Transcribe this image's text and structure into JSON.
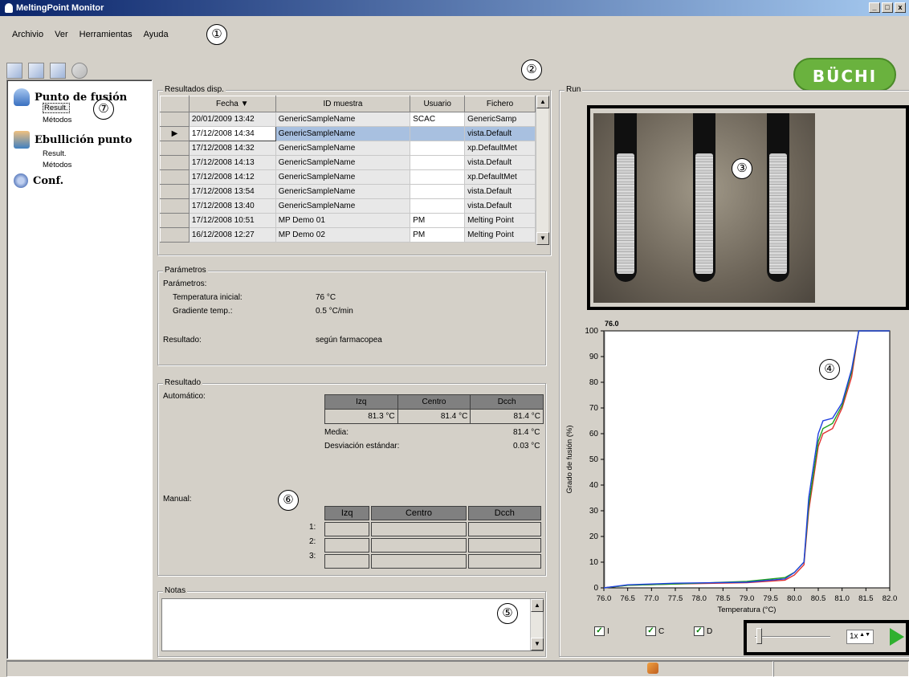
{
  "window": {
    "title": "MeltingPoint Monitor",
    "min": "_",
    "max": "□",
    "close": "x"
  },
  "menu": [
    "Archivio",
    "Ver",
    "Herramientas",
    "Ayuda"
  ],
  "callouts": [
    "①",
    "②",
    "③",
    "④",
    "⑤",
    "⑥",
    "⑦"
  ],
  "logo": "BÜCHI",
  "sidebar": {
    "melting": {
      "title": "Punto de fusión",
      "result": "Result.",
      "methods": "Métodos"
    },
    "boiling": {
      "title": "Ebullición punto",
      "result": "Result.",
      "methods": "Métodos"
    },
    "conf": "Conf."
  },
  "results": {
    "title": "Resultados disp.",
    "headers": {
      "date": "Fecha",
      "sample": "ID muestra",
      "user": "Usuario",
      "file": "Fichero"
    },
    "rows": [
      {
        "date": "20/01/2009 13:42",
        "sample": "GenericSampleName",
        "user": "SCAC",
        "file": "GenericSamp"
      },
      {
        "date": "17/12/2008 14:34",
        "sample": "GenericSampleName",
        "user": "",
        "file": "vista.Default",
        "marker": "▶"
      },
      {
        "date": "17/12/2008 14:32",
        "sample": "GenericSampleName",
        "user": "",
        "file": "xp.DefaultMet"
      },
      {
        "date": "17/12/2008 14:13",
        "sample": "GenericSampleName",
        "user": "",
        "file": "vista.Default"
      },
      {
        "date": "17/12/2008 14:12",
        "sample": "GenericSampleName",
        "user": "",
        "file": "xp.DefaultMet"
      },
      {
        "date": "17/12/2008 13:54",
        "sample": "GenericSampleName",
        "user": "",
        "file": "vista.Default"
      },
      {
        "date": "17/12/2008 13:40",
        "sample": "GenericSampleName",
        "user": "",
        "file": "vista.Default"
      },
      {
        "date": "17/12/2008 10:51",
        "sample": "MP Demo 01",
        "user": "PM",
        "file": "Melting Point"
      },
      {
        "date": "16/12/2008 12:27",
        "sample": "MP Demo 02",
        "user": "PM",
        "file": "Melting Point"
      }
    ]
  },
  "params": {
    "title": "Parámetros",
    "subtitle": "Parámetros:",
    "start_temp_label": "Temperatura inicial:",
    "start_temp": "76 °C",
    "gradient_label": "Gradiente temp.:",
    "gradient": "0.5 °C/min",
    "result_label": "Resultado:",
    "result": "según farmacopea"
  },
  "result": {
    "title": "Resultado",
    "auto_label": "Automático:",
    "cols": [
      "Izq",
      "Centro",
      "Dcch"
    ],
    "auto_values": [
      "81.3 °C",
      "81.4 °C",
      "81.4 °C"
    ],
    "mean_label": "Media:",
    "mean": "81.4 °C",
    "sd_label": "Desviación estándar:",
    "sd": "0.03 °C",
    "manual_label": "Manual:",
    "manual_rows": [
      "1:",
      "2:",
      "3:"
    ]
  },
  "notes": {
    "title": "Notas",
    "text": ""
  },
  "run": {
    "title": "Run"
  },
  "chart_data": {
    "type": "line",
    "title": "",
    "xlabel": "Temperatura (°C)",
    "ylabel": "Grado de fusión (%)",
    "xlim": [
      76.0,
      82.0
    ],
    "ylim": [
      0,
      100
    ],
    "xticks": [
      "76.0",
      "76.5",
      "77.0",
      "77.5",
      "78.0",
      "78.5",
      "79.0",
      "79.5",
      "80.0",
      "80.5",
      "81.0",
      "81.5",
      "82.0"
    ],
    "yticks": [
      0,
      10,
      20,
      30,
      40,
      50,
      60,
      70,
      80,
      90,
      100
    ],
    "cursor_label": "76.0",
    "grid": false,
    "series": [
      {
        "color": "#e03030",
        "x": [
          76.0,
          76.5,
          77.5,
          79.0,
          79.8,
          80.0,
          80.2,
          80.3,
          80.5,
          80.6,
          80.8,
          81.0,
          81.2,
          81.35,
          81.6,
          82.0
        ],
        "y": [
          0,
          1,
          1.5,
          2,
          3,
          5,
          9,
          30,
          55,
          60,
          62,
          70,
          82,
          100,
          100,
          100
        ]
      },
      {
        "color": "#20a020",
        "x": [
          76.0,
          76.5,
          77.5,
          79.0,
          79.8,
          80.0,
          80.2,
          80.3,
          80.5,
          80.6,
          80.8,
          81.0,
          81.2,
          81.35,
          81.6,
          82.0
        ],
        "y": [
          0,
          1,
          1.5,
          2.5,
          4,
          6,
          10,
          32,
          57,
          62,
          64,
          71,
          84,
          100,
          100,
          100
        ]
      },
      {
        "color": "#2040e0",
        "x": [
          76.0,
          76.5,
          77.5,
          79.0,
          79.8,
          80.0,
          80.2,
          80.3,
          80.5,
          80.6,
          80.8,
          81.0,
          81.2,
          81.35,
          81.6,
          82.0
        ],
        "y": [
          0,
          1.2,
          1.8,
          2.2,
          3.5,
          6,
          10,
          35,
          60,
          65,
          66,
          72,
          85,
          100,
          100,
          100
        ]
      }
    ]
  },
  "channels": {
    "left": "I",
    "center": "C",
    "right": "D",
    "check": "✓"
  },
  "player": {
    "speed": "1x",
    "spin": "▲▼"
  }
}
